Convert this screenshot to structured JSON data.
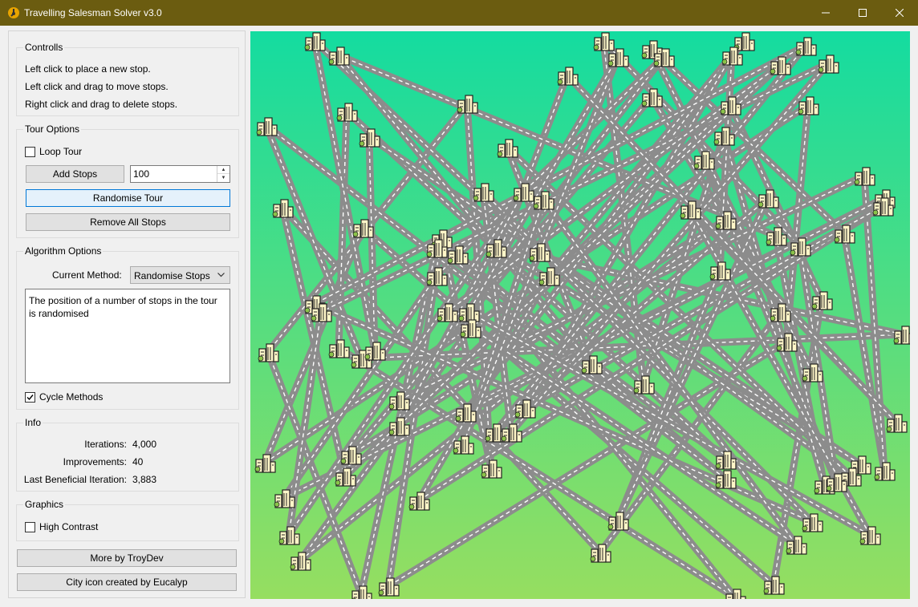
{
  "window": {
    "title": "Travelling Salesman Solver v3.0",
    "titlebar_color": "#6b5c10"
  },
  "controls": {
    "title": "Controlls",
    "lines": [
      "Left click to place a new stop.",
      "Left click and drag to move stops.",
      "Right click and drag to delete stops."
    ]
  },
  "tour_options": {
    "title": "Tour Options",
    "loop_tour_label": "Loop Tour",
    "loop_tour_checked": false,
    "add_stops_label": "Add Stops",
    "add_stops_value": "100",
    "randomise_label": "Randomise Tour",
    "remove_all_label": "Remove All Stops"
  },
  "algorithm": {
    "title": "Algorithm Options",
    "method_label": "Current Method:",
    "method_value": "Randomise Stops",
    "description": "The position of a number of stops in the tour is randomised",
    "cycle_label": "Cycle Methods",
    "cycle_checked": true
  },
  "info": {
    "title": "Info",
    "iterations_label": "Iterations:",
    "iterations_value": "4,000",
    "improvements_label": "Improvements:",
    "improvements_value": "40",
    "last_label": "Last Beneficial Iteration:",
    "last_value": "3,883"
  },
  "graphics": {
    "title": "Graphics",
    "high_contrast_label": "High Contrast",
    "high_contrast_checked": false
  },
  "links": {
    "more_label": "More by TroyDev",
    "icon_credit_label": "City icon created by Eucalyp"
  },
  "map": {
    "gradient_top": "#14dca0",
    "gradient_bottom": "#96de60",
    "road_color": "#8c8c8c",
    "stop_icon": "city-icon"
  }
}
